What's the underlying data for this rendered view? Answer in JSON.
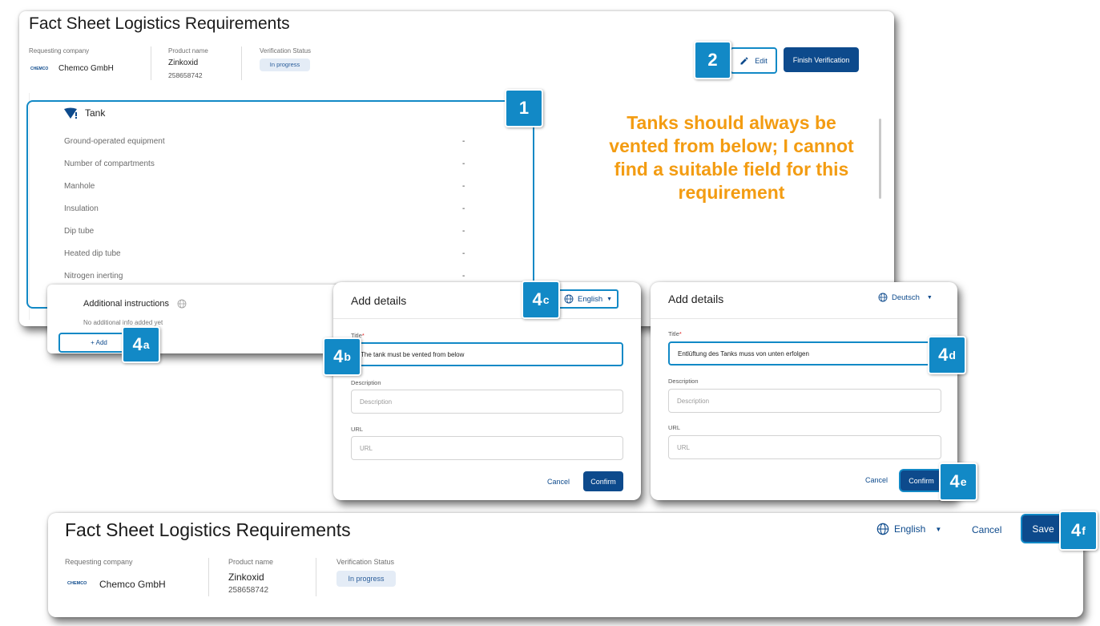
{
  "main": {
    "title": "Fact Sheet Logistics Requirements",
    "requesting_company_label": "Requesting company",
    "company_logo_text": "CHEMCO",
    "company_name": "Chemco GmbH",
    "product_name_label": "Product name",
    "product_name": "Zinkoxid",
    "product_number": "258658742",
    "verification_status_label": "Verification Status",
    "verification_status": "In progress",
    "edit_label": "Edit",
    "finish_label": "Finish Verification"
  },
  "tank": {
    "heading": "Tank",
    "rows": [
      {
        "label": "Ground-operated equipment",
        "value": "-"
      },
      {
        "label": "Number of compartments",
        "value": "-"
      },
      {
        "label": "Manhole",
        "value": "-"
      },
      {
        "label": "Insulation",
        "value": "-"
      },
      {
        "label": "Dip tube",
        "value": "-"
      },
      {
        "label": "Heated dip tube",
        "value": "-"
      },
      {
        "label": "Nitrogen inerting",
        "value": "-"
      }
    ]
  },
  "note": "Tanks should always be vented from below; I cannot find a suitable field for this requirement",
  "additional": {
    "title": "Additional instructions",
    "empty_text": "No additional info added yet",
    "add_label": "+ Add"
  },
  "dialog_en": {
    "title": "Add details",
    "language": "English",
    "title_label": "Title",
    "required_mark": "*",
    "title_value": "The tank must be vented from below",
    "description_label": "Description",
    "description_placeholder": "Description",
    "url_label": "URL",
    "url_placeholder": "URL",
    "cancel_label": "Cancel",
    "confirm_label": "Confirm"
  },
  "dialog_de": {
    "title": "Add details",
    "language": "Deutsch",
    "title_label": "Title",
    "required_mark": "*",
    "title_value": "Entlüftung des Tanks muss von unten erfolgen",
    "description_label": "Description",
    "description_placeholder": "Description",
    "url_label": "URL",
    "url_placeholder": "URL",
    "cancel_label": "Cancel",
    "confirm_label": "Confirm"
  },
  "bottom": {
    "title": "Fact Sheet Logistics Requirements",
    "language": "English",
    "cancel_label": "Cancel",
    "save_label": "Save",
    "requesting_company_label": "Requesting company",
    "company_logo_text": "CHEMCO",
    "company_name": "Chemco GmbH",
    "product_name_label": "Product name",
    "product_name": "Zinkoxid",
    "product_number": "258658742",
    "verification_status_label": "Verification Status",
    "verification_status": "In progress"
  },
  "callouts": {
    "c1": "1",
    "c2": "2",
    "c4": "4",
    "sub_a": "a",
    "sub_b": "b",
    "sub_c": "c",
    "sub_d": "d",
    "sub_e": "e",
    "sub_f": "f"
  },
  "colors": {
    "accent": "#0d4a8c",
    "callout": "#1289c6",
    "note": "#f39c12"
  }
}
